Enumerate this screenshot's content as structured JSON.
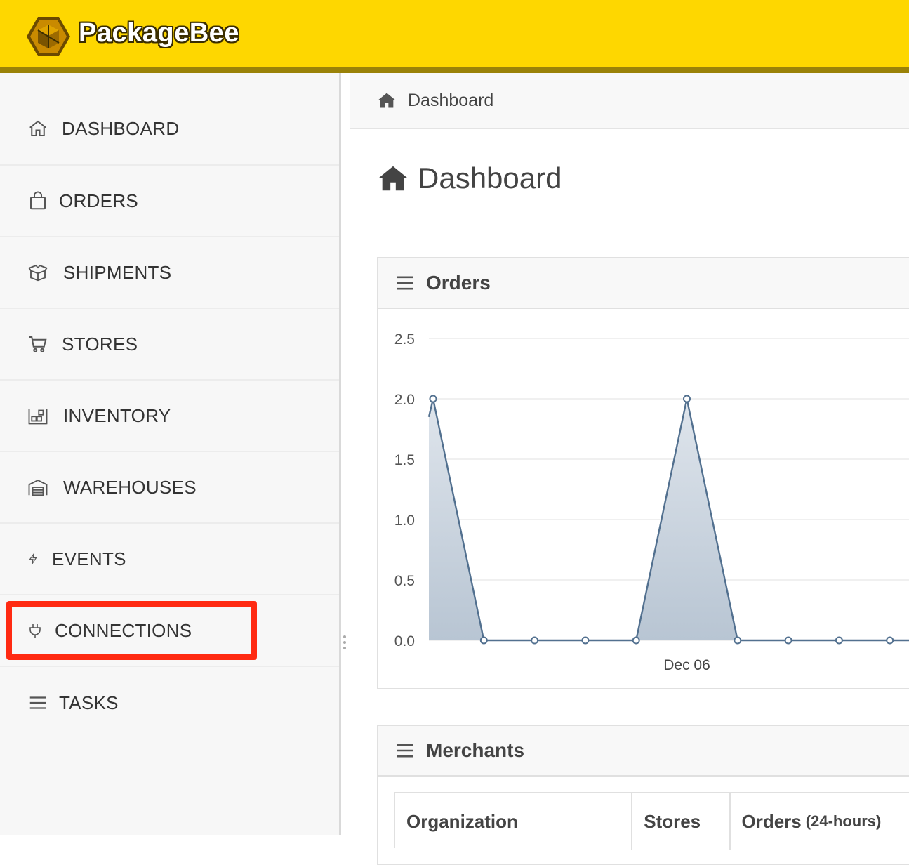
{
  "app": {
    "brand": "PackageBee"
  },
  "sidebar": {
    "items": [
      {
        "label": "DASHBOARD",
        "icon": "home-outline-icon"
      },
      {
        "label": "ORDERS",
        "icon": "shopping-bag-icon"
      },
      {
        "label": "SHIPMENTS",
        "icon": "package-open-icon"
      },
      {
        "label": "STORES",
        "icon": "shopping-cart-icon"
      },
      {
        "label": "INVENTORY",
        "icon": "warehouse-shelves-icon"
      },
      {
        "label": "WAREHOUSES",
        "icon": "garage-icon"
      },
      {
        "label": "EVENTS",
        "icon": "lightning-icon"
      },
      {
        "label": "CONNECTIONS",
        "icon": "plug-icon"
      },
      {
        "label": "TASKS",
        "icon": "list-icon"
      }
    ],
    "highlighted": "CONNECTIONS",
    "highlight_color": "#ff2a12"
  },
  "breadcrumb": {
    "label": "Dashboard",
    "icon": "home-icon"
  },
  "page": {
    "title": "Dashboard",
    "icon": "home-icon"
  },
  "orders_panel": {
    "title": "Orders",
    "icon": "menu-icon"
  },
  "merchants_panel": {
    "title": "Merchants",
    "icon": "menu-icon",
    "columns": [
      "Organization",
      "Stores",
      "Orders"
    ],
    "orders_suffix": "(24-hours)"
  },
  "colors": {
    "brand_yellow": "#fed700",
    "brand_dark": "#9a8208",
    "series_line": "#52708f",
    "series_fill": "#b8c5d3"
  },
  "chart_data": {
    "type": "area",
    "title": "",
    "xlabel": "",
    "ylabel": "",
    "ylim": [
      0,
      2.5
    ],
    "yticks": [
      "0.0",
      "0.5",
      "1.0",
      "1.5",
      "2.0",
      "2.5"
    ],
    "x_tick_labels": [
      {
        "index": 6,
        "label": "Dec 06"
      }
    ],
    "grid": true,
    "series": [
      {
        "values": [
          1.85,
          2,
          0,
          0,
          0,
          0,
          2,
          0,
          0,
          0,
          0,
          0
        ]
      }
    ]
  }
}
